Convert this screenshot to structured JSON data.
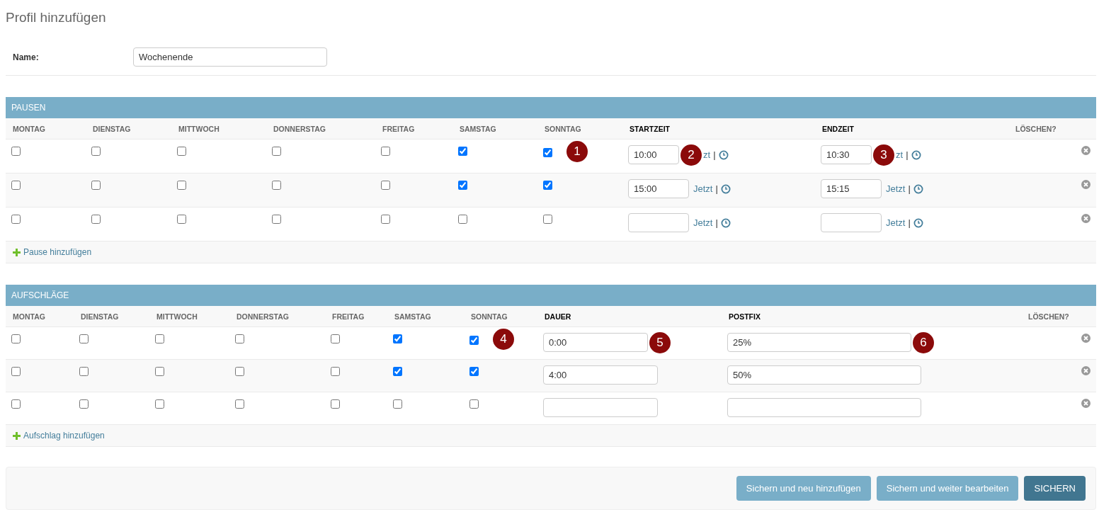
{
  "title": "Profil hinzufügen",
  "name_field": {
    "label": "Name:",
    "value": "Wochenende"
  },
  "sections": [
    {
      "kind": "pausen",
      "title": "PAUSEN",
      "columns": [
        {
          "label": "MONTAG",
          "required": false
        },
        {
          "label": "DIENSTAG",
          "required": false
        },
        {
          "label": "MITTWOCH",
          "required": false
        },
        {
          "label": "DONNERSTAG",
          "required": false
        },
        {
          "label": "FREITAG",
          "required": false
        },
        {
          "label": "SAMSTAG",
          "required": false
        },
        {
          "label": "SONNTAG",
          "required": false
        },
        {
          "label": "STARTZEIT",
          "required": true
        },
        {
          "label": "ENDZEIT",
          "required": true
        },
        {
          "label": "LÖSCHEN?",
          "required": false
        }
      ],
      "rows": [
        {
          "days": [
            {
              "checked": false
            },
            {
              "checked": false
            },
            {
              "checked": false
            },
            {
              "checked": false
            },
            {
              "checked": false
            },
            {
              "checked": true
            },
            {
              "checked": true,
              "marker": "1"
            }
          ],
          "fields": [
            {
              "kind": "time",
              "value": "10:00",
              "marker": "2",
              "link": "zt",
              "separator": "|"
            },
            {
              "kind": "time",
              "value": "10:30",
              "marker": "3",
              "link": "zt",
              "separator": "|"
            }
          ]
        },
        {
          "days": [
            {
              "checked": false
            },
            {
              "checked": false
            },
            {
              "checked": false
            },
            {
              "checked": false
            },
            {
              "checked": false
            },
            {
              "checked": true
            },
            {
              "checked": true
            }
          ],
          "fields": [
            {
              "kind": "time",
              "value": "15:00",
              "link": "Jetzt",
              "separator": "|"
            },
            {
              "kind": "time",
              "value": "15:15",
              "link": "Jetzt",
              "separator": "|"
            }
          ]
        },
        {
          "days": [
            {
              "checked": false
            },
            {
              "checked": false
            },
            {
              "checked": false
            },
            {
              "checked": false
            },
            {
              "checked": false
            },
            {
              "checked": false
            },
            {
              "checked": false
            }
          ],
          "fields": [
            {
              "kind": "time",
              "link": "Jetzt",
              "separator": "|"
            },
            {
              "kind": "time",
              "link": "Jetzt",
              "separator": "|"
            }
          ]
        }
      ],
      "add_link": "Pause hinzufügen"
    },
    {
      "kind": "aufschlaege",
      "title": "AUFSCHLÄGE",
      "columns": [
        {
          "label": "MONTAG",
          "required": false
        },
        {
          "label": "DIENSTAG",
          "required": false
        },
        {
          "label": "MITTWOCH",
          "required": false
        },
        {
          "label": "DONNERSTAG",
          "required": false
        },
        {
          "label": "FREITAG",
          "required": false
        },
        {
          "label": "SAMSTAG",
          "required": false
        },
        {
          "label": "SONNTAG",
          "required": false
        },
        {
          "label": "DAUER",
          "required": true
        },
        {
          "label": "POSTFIX",
          "required": true
        },
        {
          "label": "LÖSCHEN?",
          "required": false
        }
      ],
      "rows": [
        {
          "days": [
            {
              "checked": false
            },
            {
              "checked": false
            },
            {
              "checked": false
            },
            {
              "checked": false
            },
            {
              "checked": false
            },
            {
              "checked": true
            },
            {
              "checked": true,
              "marker": "4"
            }
          ],
          "fields": [
            {
              "kind": "short",
              "value": "0:00",
              "marker": "5"
            },
            {
              "kind": "wide",
              "value": "25%",
              "marker": "6"
            }
          ]
        },
        {
          "days": [
            {
              "checked": false
            },
            {
              "checked": false
            },
            {
              "checked": false
            },
            {
              "checked": false
            },
            {
              "checked": false
            },
            {
              "checked": true
            },
            {
              "checked": true
            }
          ],
          "fields": [
            {
              "kind": "short",
              "value": "4:00"
            },
            {
              "kind": "wide",
              "value": "50%"
            }
          ]
        },
        {
          "days": [
            {
              "checked": false
            },
            {
              "checked": false
            },
            {
              "checked": false
            },
            {
              "checked": false
            },
            {
              "checked": false
            },
            {
              "checked": false
            },
            {
              "checked": false
            }
          ],
          "fields": [
            {
              "kind": "short"
            },
            {
              "kind": "wide"
            }
          ]
        }
      ],
      "add_link": "Aufschlag hinzufügen"
    }
  ],
  "buttons": [
    {
      "label": "Sichern und neu hinzufügen",
      "primary": false
    },
    {
      "label": "Sichern und weiter bearbeiten",
      "primary": false
    },
    {
      "label": "SICHERN",
      "primary": true
    }
  ]
}
